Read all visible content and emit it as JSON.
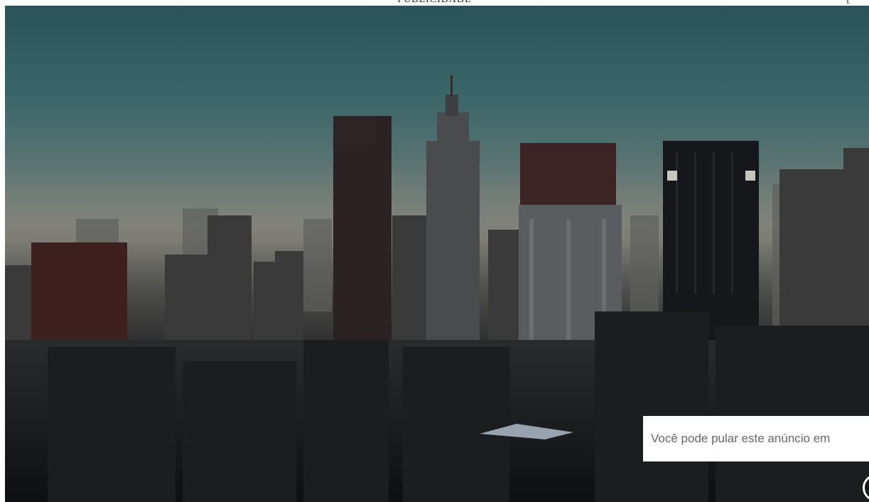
{
  "header": {
    "ad_label": "PUBLICIDADE",
    "bracket": "["
  },
  "video": {
    "skip_notice": "Você pode pular este anúncio em",
    "icon": "ad-info-icon"
  },
  "colors": {
    "sky_top": "#2a5357",
    "haze": "#7a7f78",
    "buildings": "#1a1b1d",
    "notice_bg": "#ffffff",
    "notice_text": "#666666"
  }
}
